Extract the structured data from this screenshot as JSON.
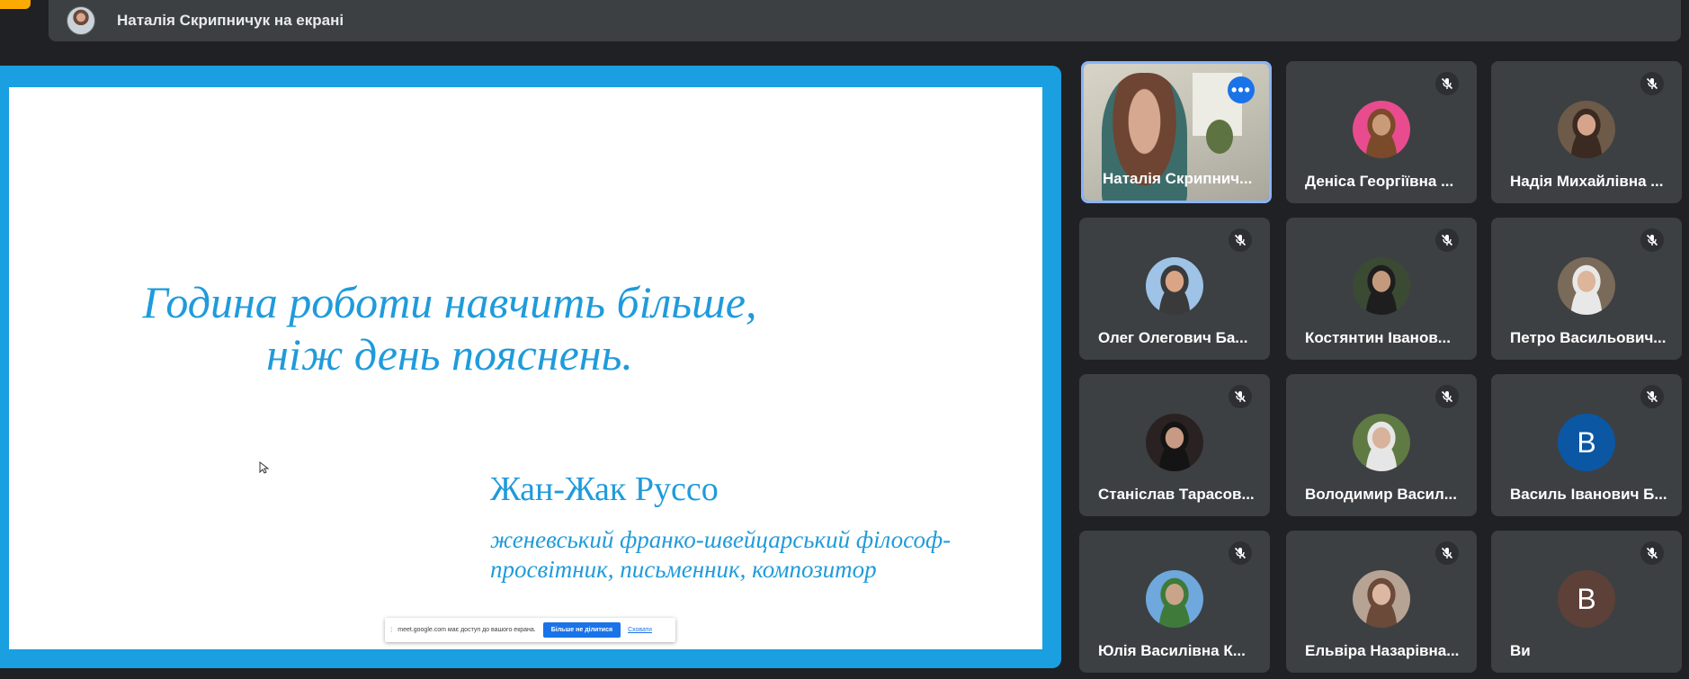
{
  "presenter_bar": {
    "label": "Наталія Скрипничук на екрані"
  },
  "slide": {
    "quote_line1": "Година роботи навчить більше,",
    "quote_line2": "ніж день пояснень.",
    "author": "Жан-Жак Руссо",
    "description_line1": "женевський франко-швейцарський філософ-",
    "description_line2": "просвітник, письменник, композитор"
  },
  "share_bar": {
    "message": "meet.google.com має доступ до вашого екрана.",
    "stop_label": "Більше не ділитися",
    "hide_label": "Сховати"
  },
  "participants": [
    {
      "name": "Наталія Скрипнич...",
      "type": "video",
      "pinned": true
    },
    {
      "name": "Деніса Георгіївна ...",
      "type": "photo",
      "muted": true,
      "photo_colors": [
        "#e84c8e",
        "#c99b79",
        "#7a4a2a"
      ]
    },
    {
      "name": "Надія Михайлівна ...",
      "type": "photo",
      "muted": true,
      "photo_colors": [
        "#6d5a48",
        "#d6a48a",
        "#3a2a22"
      ]
    },
    {
      "name": "Олег Олегович Ба...",
      "type": "photo",
      "muted": true,
      "photo_colors": [
        "#9ec3e6",
        "#d9a586",
        "#3a3a3a"
      ]
    },
    {
      "name": "Костянтин Іванов...",
      "type": "photo",
      "muted": true,
      "photo_colors": [
        "#3b4a33",
        "#c49a7c",
        "#1e1e1e"
      ]
    },
    {
      "name": "Петро Васильович...",
      "type": "photo",
      "muted": true,
      "photo_colors": [
        "#7a6a5a",
        "#dcb59a",
        "#e8e8e8"
      ]
    },
    {
      "name": "Станіслав Тарасов...",
      "type": "photo",
      "muted": true,
      "photo_colors": [
        "#2a2222",
        "#c79a84",
        "#141414"
      ]
    },
    {
      "name": "Володимир Васил...",
      "type": "photo",
      "muted": true,
      "photo_colors": [
        "#5f7a42",
        "#d8b29a",
        "#e6e6e6"
      ]
    },
    {
      "name": "Василь Іванович Б...",
      "type": "letter",
      "letter": "В",
      "muted": true,
      "avatar_color": "#0b57a4"
    },
    {
      "name": "Юлія Василівна К...",
      "type": "photo",
      "muted": true,
      "photo_colors": [
        "#6fa8dc",
        "#caa488",
        "#3f7a3a"
      ]
    },
    {
      "name": "Ельвіра Назарівна...",
      "type": "photo",
      "muted": true,
      "photo_colors": [
        "#b7a394",
        "#dcb8a2",
        "#6b4a3a"
      ]
    },
    {
      "name": "Ви",
      "type": "letter",
      "letter": "В",
      "muted": true,
      "avatar_color": "#5d4037"
    }
  ]
}
